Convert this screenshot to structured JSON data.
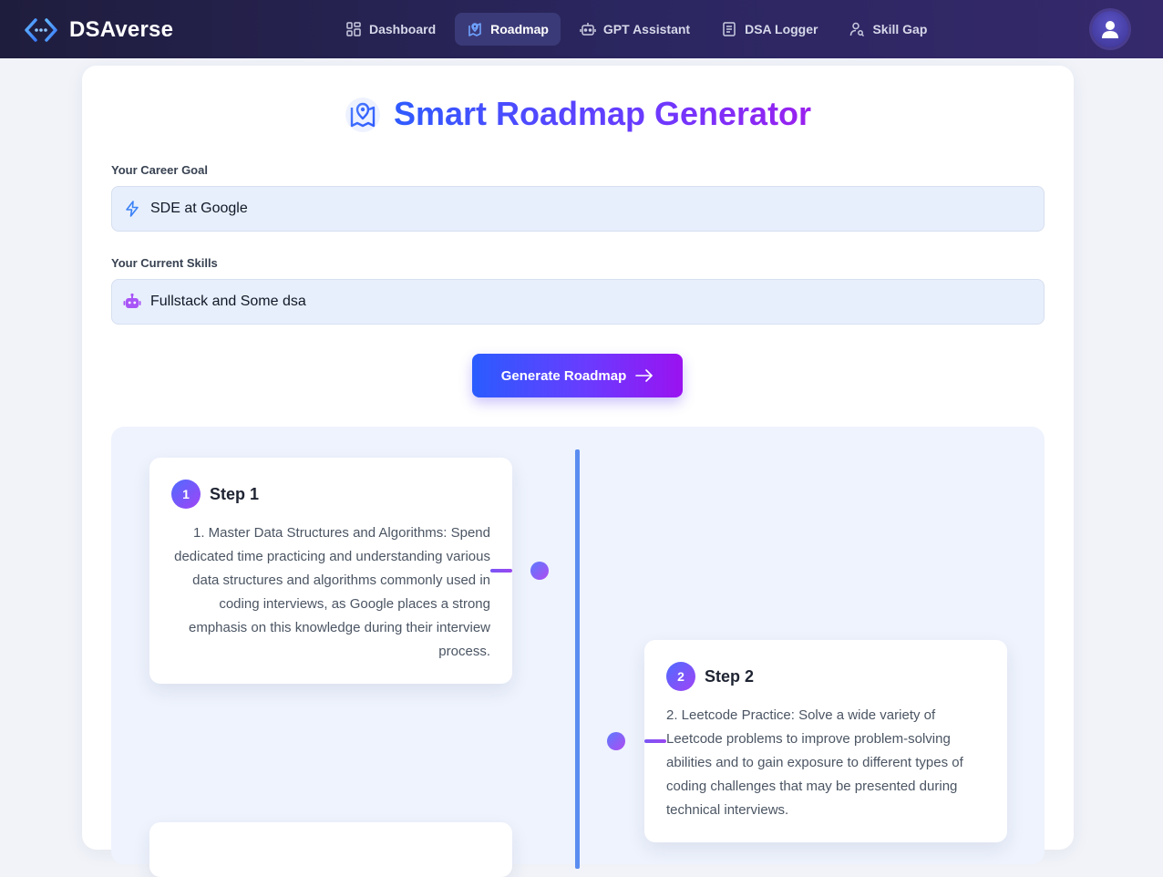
{
  "app": {
    "name": "DSAverse"
  },
  "nav": {
    "items": [
      {
        "label": "Dashboard",
        "icon": "dashboard-icon"
      },
      {
        "label": "Roadmap",
        "icon": "map-icon",
        "active": true
      },
      {
        "label": "GPT Assistant",
        "icon": "bot-icon"
      },
      {
        "label": "DSA Logger",
        "icon": "document-icon"
      },
      {
        "label": "Skill Gap",
        "icon": "user-search-icon"
      }
    ]
  },
  "page": {
    "title": "Smart Roadmap Generator"
  },
  "form": {
    "goal_label": "Your Career Goal",
    "goal_value": "SDE at Google",
    "skills_label": "Your Current Skills",
    "skills_value": "Fullstack and Some dsa",
    "generate_label": "Generate Roadmap"
  },
  "roadmap": {
    "steps": [
      {
        "number": "1",
        "title": "Step 1",
        "text": "1. Master Data Structures and Algorithms: Spend dedicated time practicing and understanding various data structures and algorithms commonly used in coding interviews, as Google places a strong emphasis on this knowledge during their interview process."
      },
      {
        "number": "2",
        "title": "Step 2",
        "text": "2. Leetcode Practice: Solve a wide variety of Leetcode problems to improve problem-solving abilities and to gain exposure to different types of coding challenges that may be presented during technical interviews."
      }
    ]
  },
  "colors": {
    "accent_start": "#2f5bff",
    "accent_end": "#9a20ee",
    "nav_bg": "#2b2660",
    "timeline": "#5b8cf0"
  }
}
